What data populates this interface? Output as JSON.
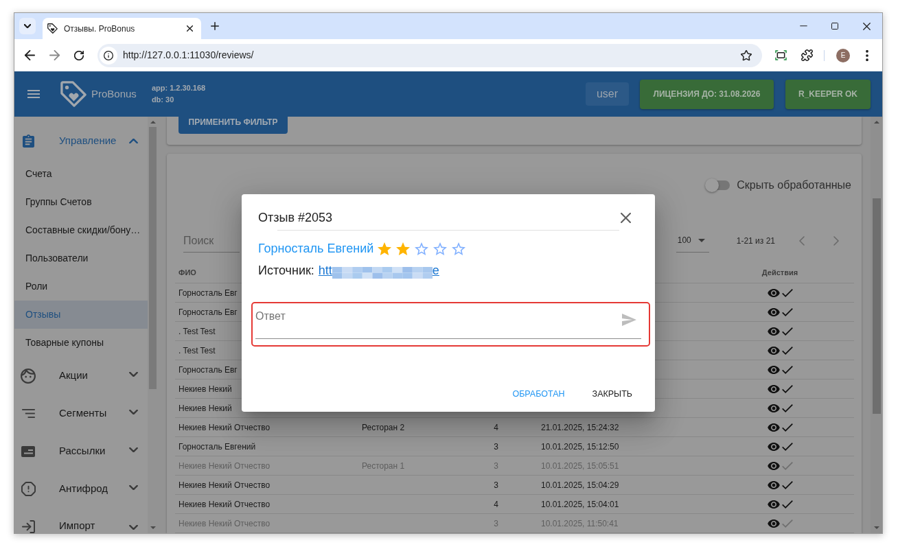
{
  "browser": {
    "tab_title": "Отзывы. ProBonus",
    "url": "http://127.0.0.1:11030/reviews/",
    "profile_initial": "E"
  },
  "header": {
    "brand": "ProBonus",
    "app_version": "app: 1.2.30.168",
    "db_version": "db: 30",
    "user_button": "user",
    "status_buttons": [
      "ЛИЦЕНЗИЯ ДО: 31.08.2026",
      "R_KEEPER OK"
    ]
  },
  "sidebar": {
    "items": [
      {
        "label": "Управление",
        "expanded": true,
        "children": [
          {
            "label": "Счета",
            "selected": false
          },
          {
            "label": "Группы Счетов",
            "selected": false
          },
          {
            "label": "Составные скидки/бону…",
            "selected": false
          },
          {
            "label": "Пользователи",
            "selected": false
          },
          {
            "label": "Роли",
            "selected": false
          },
          {
            "label": "Отзывы",
            "selected": true
          },
          {
            "label": "Товарные купоны",
            "selected": false
          }
        ]
      },
      {
        "label": "Акции",
        "expanded": false
      },
      {
        "label": "Сегменты",
        "expanded": false
      },
      {
        "label": "Рассылки",
        "expanded": false
      },
      {
        "label": "Антифрод",
        "expanded": false
      },
      {
        "label": "Импорт",
        "expanded": false
      }
    ]
  },
  "filter": {
    "apply_button": "ПРИМЕНИТЬ ФИЛЬТР"
  },
  "reviews": {
    "hide_processed": {
      "label": "Скрыть обработанные",
      "on": false
    },
    "search": {
      "placeholder": "Поиск"
    },
    "rows_per_page": "100",
    "range": "1-21 из 21",
    "columns": {
      "name": "ФИО",
      "actions": "Действия"
    },
    "rows": [
      {
        "name": "Горносталь Евг",
        "processed": false
      },
      {
        "name": "Горносталь Евг",
        "processed": false
      },
      {
        "name": ". Test Test",
        "processed": false
      },
      {
        "name": ". Test Test",
        "processed": false
      },
      {
        "name": "Горносталь Евг",
        "processed": false
      },
      {
        "name": "Некиев Некий",
        "processed": false
      },
      {
        "name": "Некиев Некий",
        "processed": false
      },
      {
        "name": "Некиев Некий Отчество",
        "column_2": "Ресторан 2",
        "column_3": "4",
        "column_4": "21.01.2025, 15:24:32",
        "processed": false
      },
      {
        "name": "Горносталь Евгений",
        "column_3": "3",
        "column_4": "10.01.2025, 15:12:50",
        "processed": false
      },
      {
        "name": "Некиев Некий Отчество",
        "column_2": "Ресторан 1",
        "column_3": "3",
        "column_4": "10.01.2025, 15:05:51",
        "processed": true
      },
      {
        "name": "Некиев Некий Отчество",
        "column_3": "3",
        "column_4": "10.01.2025, 15:04:29",
        "processed": false
      },
      {
        "name": "Некиев Некий Отчество",
        "column_3": "4",
        "column_4": "10.01.2025, 15:04:01",
        "processed": false
      },
      {
        "name": "Некиев Некий Отчество",
        "column_3": "3",
        "column_4": "10.01.2025, 11:50:41",
        "processed": true
      }
    ]
  },
  "dialog": {
    "title": "Отзыв #2053",
    "author": "Горносталь Евгений",
    "stars": 2,
    "source_label": "Источник:",
    "source_link": [
      "htt",
      "e"
    ],
    "answer": {
      "placeholder": "Ответ"
    },
    "buttons": [
      {
        "label": "ОБРАБОТАН",
        "kind": "primary"
      },
      {
        "label": "ЗАКРЫТЬ",
        "kind": "secondary"
      }
    ]
  }
}
